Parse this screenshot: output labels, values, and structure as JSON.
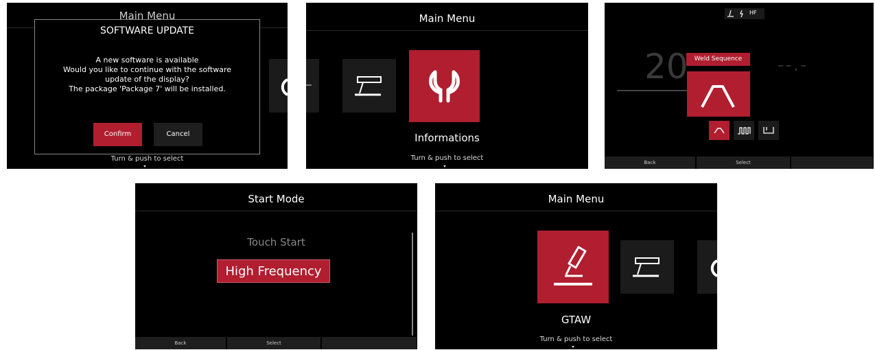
{
  "screen1": {
    "title": "Main Menu",
    "dialog": {
      "title": "SOFTWARE UPDATE",
      "lines": [
        "A new software is available",
        "Would you like to continue with the software",
        "update of the display?",
        "The package 'Package 7' will be installed."
      ],
      "confirm_label": "Confirm",
      "cancel_label": "Cancel"
    },
    "hint": "Turn & push to select"
  },
  "screen2": {
    "title": "Main Menu",
    "selected_label": "Informations",
    "hint": "Turn & push to select"
  },
  "screen3": {
    "status_hf": "HF",
    "big_value": "20",
    "dashes": "--.-",
    "tooltip": "Weld Sequence",
    "footer": {
      "back": "Back",
      "select": "Select"
    }
  },
  "screen4": {
    "title": "Start Mode",
    "option_touch": "Touch Start",
    "option_hf": "High Frequency",
    "footer": {
      "back": "Back",
      "select": "Select"
    }
  },
  "screen5": {
    "title": "Main Menu",
    "selected_label": "GTAW",
    "hint": "Turn & push to select"
  },
  "colors": {
    "accent": "#b01e2f",
    "tile": "#1b1b1b",
    "background": "#000000"
  }
}
